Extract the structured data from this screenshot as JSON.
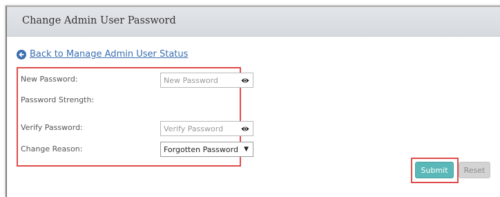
{
  "panel": {
    "title": "Change Admin User Password"
  },
  "back_link": {
    "label": "Back to Manage Admin User Status",
    "icon": "arrow-left-circle-icon"
  },
  "form": {
    "new_password": {
      "label": "New Password:",
      "placeholder": "New Password",
      "icon": "eye-icon"
    },
    "password_strength": {
      "label": "Password Strength:"
    },
    "verify_password": {
      "label": "Verify Password:",
      "placeholder": "Verify Password",
      "icon": "eye-icon"
    },
    "change_reason": {
      "label": "Change Reason:",
      "selected": "Forgotten Password",
      "caret": "▼"
    }
  },
  "buttons": {
    "submit": "Submit",
    "reset": "Reset"
  },
  "colors": {
    "link": "#3a6fb0",
    "highlight": "#e04a4a",
    "submit": "#5bb8b8",
    "reset": "#d3d3d3"
  }
}
